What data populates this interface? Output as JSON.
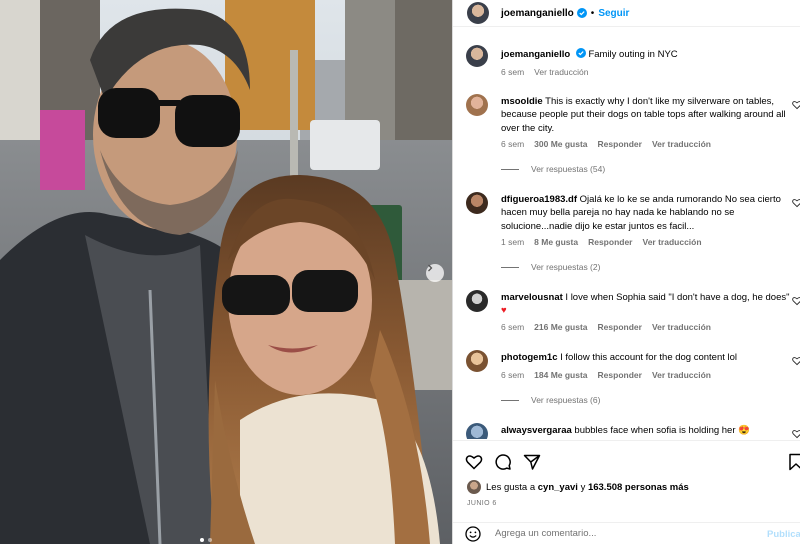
{
  "post": {
    "username": "joemanganiello",
    "follow_label": "Seguir",
    "separator": "•",
    "caption": {
      "username": "joemanganiello",
      "text": "Family outing in NYC",
      "time": "6 sem",
      "translate_label": "Ver traducción"
    }
  },
  "comments": [
    {
      "username": "msooldie",
      "text": "This is exactly why I don't like my silverware on tables, because people put their dogs on table tops after walking around all over the city.",
      "time": "6 sem",
      "likes": "300 Me gusta",
      "reply_label": "Responder",
      "translate_label": "Ver traducción",
      "replies_label": "Ver respuestas (54)"
    },
    {
      "username": "dfigueroa1983.df",
      "text": "Ojalá ke lo ke se anda rumorando No sea cierto hacen muy bella pareja no hay nada ke hablando no se solucione...nadie dijo ke estar juntos es facil...",
      "time": "1 sem",
      "likes": "8 Me gusta",
      "reply_label": "Responder",
      "translate_label": "Ver traducción",
      "replies_label": "Ver respuestas (2)"
    },
    {
      "username": "marvelousnat",
      "text": "I love when Sophia said \"I don't have a dog, he does\"",
      "emoji": "♥",
      "time": "6 sem",
      "likes": "216 Me gusta",
      "reply_label": "Responder",
      "translate_label": "Ver traducción"
    },
    {
      "username": "photogem1c",
      "text": "I follow this account for the dog content lol",
      "time": "6 sem",
      "likes": "184 Me gusta",
      "reply_label": "Responder",
      "translate_label": "Ver traducción",
      "replies_label": "Ver respuestas (6)"
    },
    {
      "username": "alwaysvergaraa",
      "text": "bubbles face when sofia is holding her",
      "emoji": "😍"
    }
  ],
  "likes": {
    "prefix": "Les gusta a",
    "user": "cyn_yavi",
    "connector": "y",
    "count": "163.508 personas más"
  },
  "date": "JUNIO 6",
  "add_comment": {
    "placeholder": "Agrega un comentario...",
    "publish_label": "Publicar"
  },
  "icons": {
    "like": "heart-icon",
    "comment": "comment-icon",
    "share": "share-icon",
    "save": "bookmark-icon",
    "emoji": "emoji-icon",
    "next": "chevron-right-icon"
  },
  "colors": {
    "link": "#0095f6",
    "muted": "#737373",
    "publish_disabled": "#b2dffc",
    "divider": "#dbdbdb"
  }
}
